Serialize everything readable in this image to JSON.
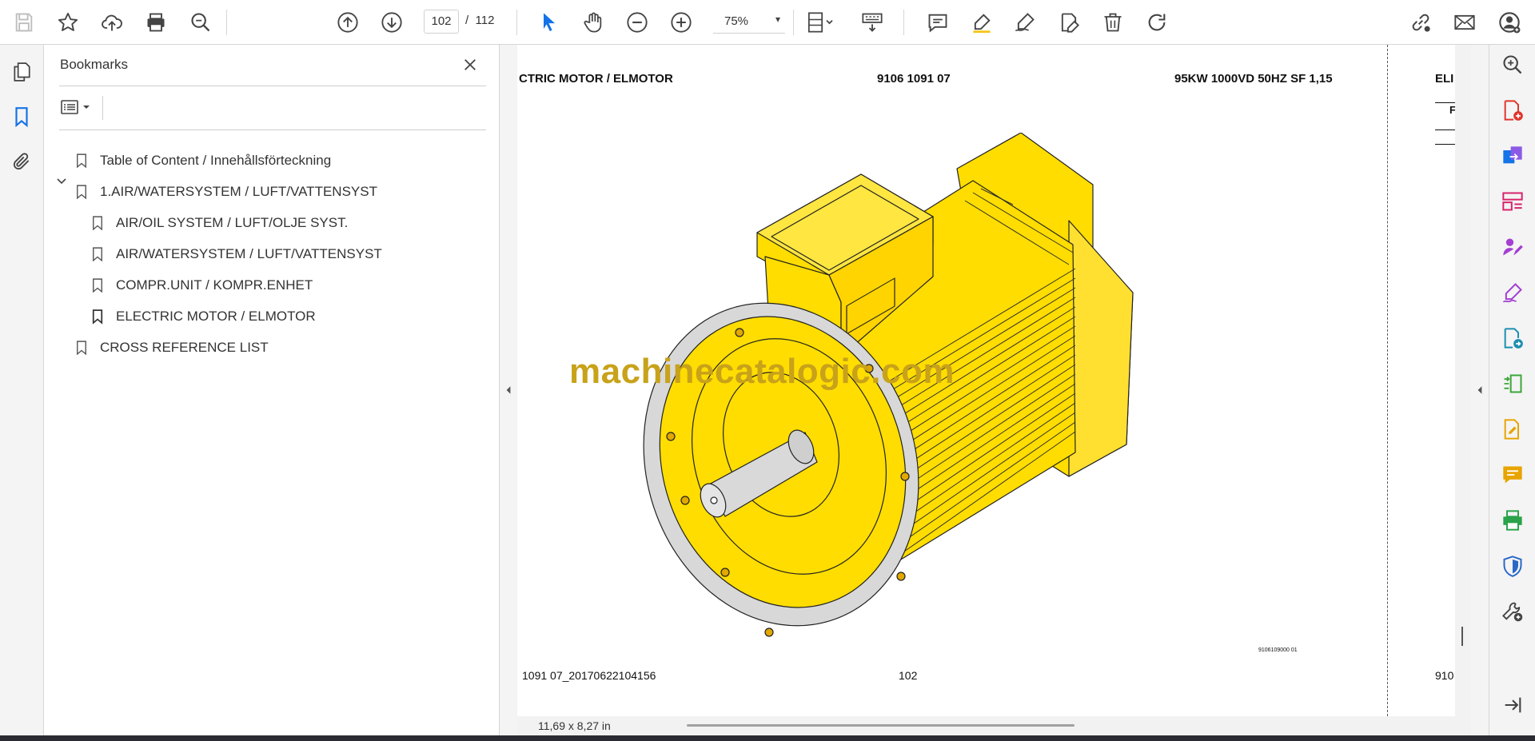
{
  "toolbar": {
    "current_page": "102",
    "page_separator": "/",
    "total_pages": "112",
    "zoom": "75%",
    "buttons": [
      "save-icon",
      "star-icon",
      "cloud-upload-icon",
      "print-icon",
      "find-icon",
      "page-up-icon",
      "page-down-icon",
      "select-cursor-icon",
      "hand-icon",
      "zoom-out-icon",
      "zoom-in-icon",
      "fit-page-icon",
      "scroll-mode-icon",
      "comment-icon",
      "highlight-icon",
      "sign-icon",
      "edit-icon",
      "delete-icon",
      "rotate-icon",
      "share-link-icon",
      "email-icon",
      "account-icon"
    ]
  },
  "bookmarks": {
    "title": "Bookmarks",
    "items": [
      {
        "label": "Table of Content / Innehållsförteckning",
        "level": 0
      },
      {
        "label": "1.AIR/WATERSYSTEM / LUFT/VATTENSYST",
        "level": 0,
        "expanded": true
      },
      {
        "label": "AIR/OIL SYSTEM / LUFT/OLJE SYST.",
        "level": 1
      },
      {
        "label": "AIR/WATERSYSTEM / LUFT/VATTENSYST",
        "level": 1
      },
      {
        "label": "COMPR.UNIT / KOMPR.ENHET",
        "level": 1
      },
      {
        "label": "ELECTRIC MOTOR / ELMOTOR",
        "level": 1,
        "selected": true
      },
      {
        "label": "CROSS REFERENCE LIST",
        "level": 0
      }
    ]
  },
  "document": {
    "header_left": "CTRIC MOTOR / ELMOTOR",
    "header_center": "9106 1091 07",
    "header_right": "95KW 1000VD 50HZ SF 1,15",
    "next_page_header": "ELI",
    "next_page_letter": "F",
    "watermark": "machinecatalogic.com",
    "image_code": "9106109000 01",
    "footer_left": "1091 07_20170622104156",
    "footer_center": "102",
    "next_page_footer": "910",
    "page_size": "11,69 x 8,27 in"
  },
  "colors": {
    "motor_yellow": "#ffdd00",
    "watermark": "#c8a21a",
    "accent_blue": "#1473e6"
  }
}
